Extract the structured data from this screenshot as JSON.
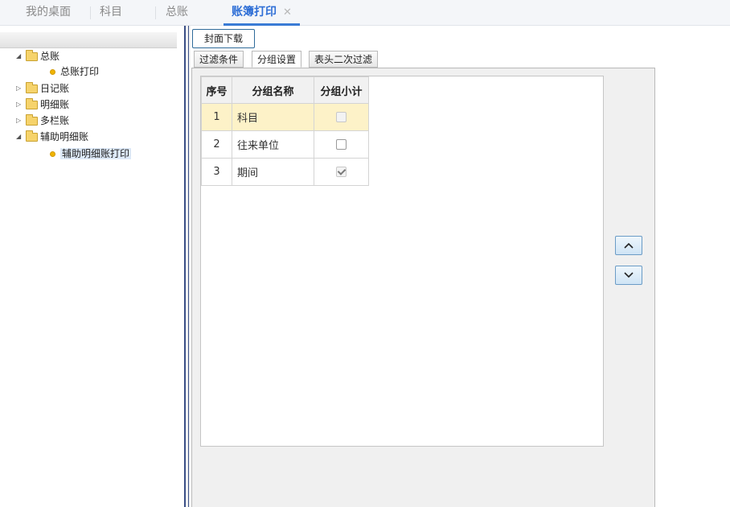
{
  "top_tabs": [
    {
      "label": "我的桌面",
      "active": false
    },
    {
      "label": "科目",
      "active": false
    },
    {
      "label": "总账",
      "active": false
    },
    {
      "label": "账簿打印",
      "active": true,
      "close": "✕"
    }
  ],
  "tree": [
    {
      "label": "总账",
      "type": "folder",
      "expanded": true
    },
    {
      "label": "总账打印",
      "type": "leaf"
    },
    {
      "label": "日记账",
      "type": "folder",
      "expanded": false
    },
    {
      "label": "明细账",
      "type": "folder",
      "expanded": false
    },
    {
      "label": "多栏账",
      "type": "folder",
      "expanded": false
    },
    {
      "label": "辅助明细账",
      "type": "folder",
      "expanded": true
    },
    {
      "label": "辅助明细账打印",
      "type": "leaf",
      "selected": true
    }
  ],
  "toolbar": {
    "cover_download": "封面下载"
  },
  "sub_tabs": [
    {
      "label": "过滤条件",
      "active": false
    },
    {
      "label": "分组设置",
      "active": true
    },
    {
      "label": "表头二次过滤",
      "active": false
    }
  ],
  "grid": {
    "headers": {
      "seq": "序号",
      "name": "分组名称",
      "subtotal": "分组小计"
    },
    "rows": [
      {
        "seq": "1",
        "name": "科目",
        "subtotal_checked": false,
        "subtotal_disabled": true,
        "highlight": true
      },
      {
        "seq": "2",
        "name": "往来单位",
        "subtotal_checked": false,
        "subtotal_disabled": false,
        "highlight": false
      },
      {
        "seq": "3",
        "name": "期间",
        "subtotal_checked": true,
        "subtotal_disabled": true,
        "highlight": false
      }
    ]
  },
  "icons": {
    "move_up": "chevron-up-icon",
    "move_down": "chevron-down-icon"
  },
  "colors": {
    "active_tab": "#2f6fd6",
    "row_highlight": "#fdf2c8",
    "folder": "#f6d36b"
  }
}
